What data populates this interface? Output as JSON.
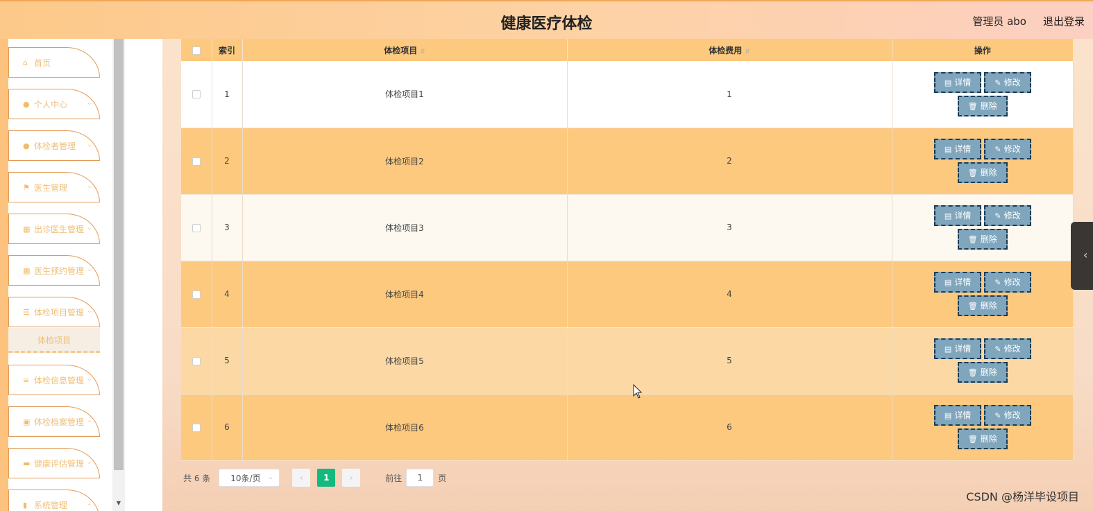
{
  "header": {
    "title": "健康医疗体检",
    "user": "管理员 abo",
    "logout": "退出登录"
  },
  "sidebar": {
    "items": [
      {
        "label": "首页",
        "icon": "home-icon",
        "glyph": "⌂",
        "chevron": false
      },
      {
        "label": "个人中心",
        "icon": "user-icon",
        "glyph": "●",
        "chevron": true
      },
      {
        "label": "体检者管理",
        "icon": "user-icon",
        "glyph": "●",
        "chevron": true
      },
      {
        "label": "医生管理",
        "icon": "flag-icon",
        "glyph": "⚑",
        "chevron": true
      },
      {
        "label": "出诊医生管理",
        "icon": "grid-icon",
        "glyph": "▦",
        "chevron": true
      },
      {
        "label": "医生预约管理",
        "icon": "grid-icon",
        "glyph": "▦",
        "chevron": true
      },
      {
        "label": "体检项目管理",
        "icon": "sliders-icon",
        "glyph": "☰",
        "chevron": true
      },
      {
        "label": "体检信息管理",
        "icon": "list-icon",
        "glyph": "≡",
        "chevron": true
      },
      {
        "label": "体检档案管理",
        "icon": "briefcase-icon",
        "glyph": "▣",
        "chevron": true
      },
      {
        "label": "健康评估管理",
        "icon": "monitor-icon",
        "glyph": "▬",
        "chevron": true
      },
      {
        "label": "系统管理",
        "icon": "chart-icon",
        "glyph": "▮",
        "chevron": true
      }
    ],
    "submenu": "体检项目"
  },
  "table": {
    "columns": [
      "索引",
      "体检项目",
      "体检费用",
      "操作"
    ],
    "rows": [
      {
        "index": "1",
        "name": "体检项目1",
        "fee": "1",
        "bg": "#ffffff"
      },
      {
        "index": "2",
        "name": "体检项目2",
        "fee": "2",
        "bg": "#fcc97f"
      },
      {
        "index": "3",
        "name": "体检项目3",
        "fee": "3",
        "bg": "#fdf8f0"
      },
      {
        "index": "4",
        "name": "体检项目4",
        "fee": "4",
        "bg": "#fcc97f"
      },
      {
        "index": "5",
        "name": "体检项目5",
        "fee": "5",
        "bg": "#fcd9a4"
      },
      {
        "index": "6",
        "name": "体检项目6",
        "fee": "6",
        "bg": "#fcc97f"
      }
    ],
    "actions": {
      "detail": "详情",
      "edit": "修改",
      "delete": "删除"
    }
  },
  "pagination": {
    "total": "共 6 条",
    "page_size": "10条/页",
    "prev": "‹",
    "current": "1",
    "next": "›",
    "goto_label": "前往",
    "goto_value": "1",
    "goto_suffix": "页"
  },
  "watermark": "CSDN @杨洋毕设项目"
}
